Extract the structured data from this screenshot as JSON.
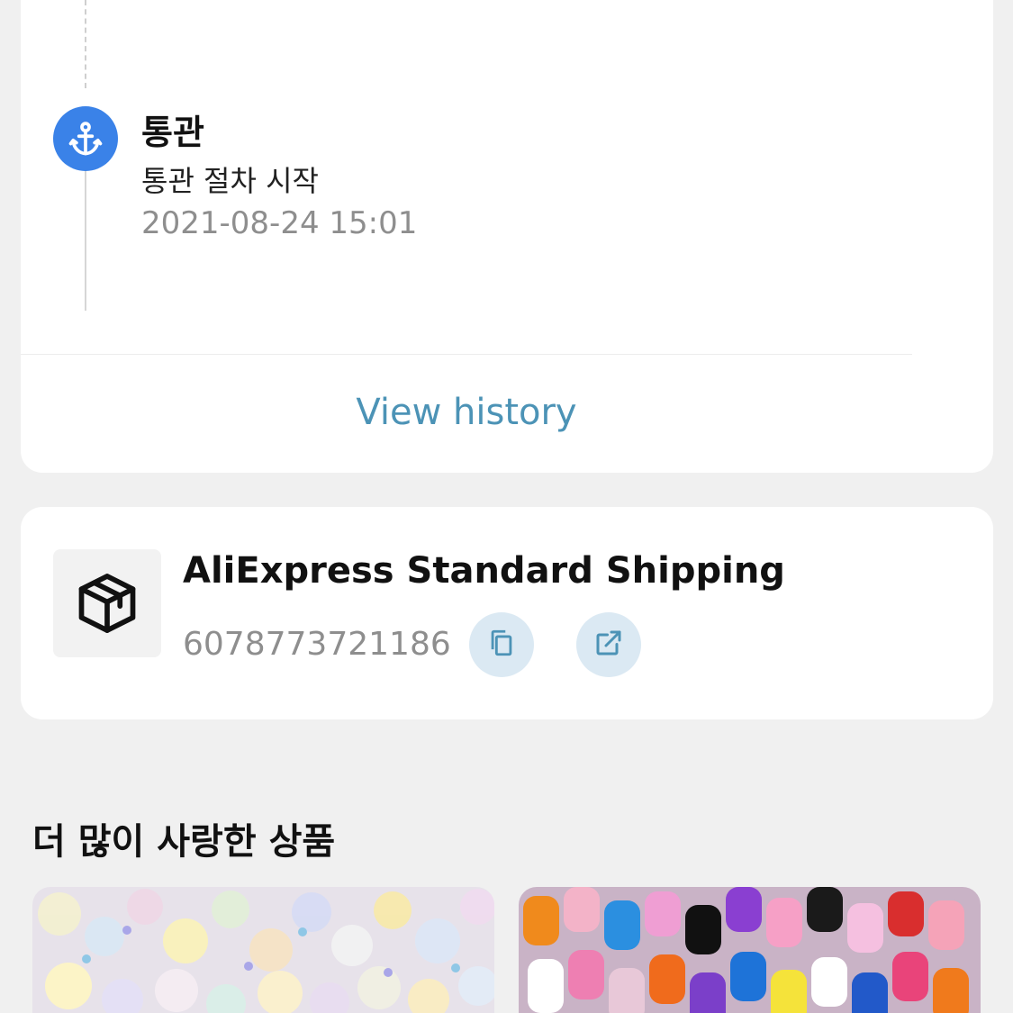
{
  "tracking": {
    "event_title": "통관",
    "event_description": "통관 절차 시작",
    "event_time": "2021-08-24 15:01",
    "event_icon": "anchor-icon",
    "view_history_label": "View history",
    "accent_color": "#3a82e8",
    "link_color": "#4c93b6"
  },
  "shipping": {
    "carrier_name": "AliExpress Standard Shipping",
    "tracking_number": "6078773721186",
    "package_icon": "package-icon",
    "copy_icon": "copy-icon",
    "external_link_icon": "external-link-icon"
  },
  "recommendations": {
    "title": "더 많이 사랑한 상품",
    "products": [
      {
        "image_desc": "pastel translucent beads"
      },
      {
        "image_desc": "colorful gummy bear charms"
      }
    ]
  }
}
